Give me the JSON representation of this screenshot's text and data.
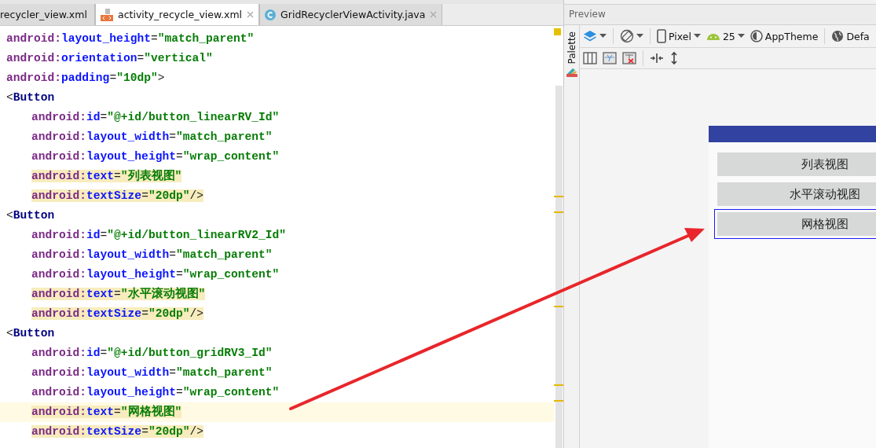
{
  "editor": {
    "tabs": [
      {
        "label": "recycler_view.xml",
        "selected": false
      },
      {
        "label": "activity_recycle_view.xml",
        "selected": true
      },
      {
        "label": "GridRecyclerViewActivity.java",
        "selected": false
      }
    ],
    "lines": [
      {
        "highlighted": false,
        "current": false,
        "segments": [
          {
            "kind": "ns",
            "text": "android:"
          },
          {
            "kind": "attr",
            "text": "layout_height"
          },
          {
            "kind": "punct",
            "text": "="
          },
          {
            "kind": "value",
            "text": "\"match_parent\""
          }
        ]
      },
      {
        "highlighted": false,
        "current": false,
        "segments": [
          {
            "kind": "ns",
            "text": "android:"
          },
          {
            "kind": "attr",
            "text": "orientation"
          },
          {
            "kind": "punct",
            "text": "="
          },
          {
            "kind": "value",
            "text": "\"vertical\""
          }
        ]
      },
      {
        "highlighted": false,
        "current": false,
        "segments": [
          {
            "kind": "ns",
            "text": "android:"
          },
          {
            "kind": "attr",
            "text": "padding"
          },
          {
            "kind": "punct",
            "text": "="
          },
          {
            "kind": "value",
            "text": "\"10dp\""
          },
          {
            "kind": "punct",
            "text": ">"
          }
        ]
      },
      {
        "highlighted": false,
        "current": false,
        "segments": [
          {
            "kind": "punct",
            "text": "<"
          },
          {
            "kind": "tag",
            "text": "Button"
          }
        ],
        "children": [
          {
            "highlighted": false,
            "current": false,
            "segments": [
              {
                "kind": "ns",
                "text": "android:"
              },
              {
                "kind": "attr",
                "text": "id"
              },
              {
                "kind": "punct",
                "text": "="
              },
              {
                "kind": "value",
                "text": "\"@+id/button_linearRV_Id\""
              }
            ]
          },
          {
            "highlighted": false,
            "current": false,
            "segments": [
              {
                "kind": "ns",
                "text": "android:"
              },
              {
                "kind": "attr",
                "text": "layout_width"
              },
              {
                "kind": "punct",
                "text": "="
              },
              {
                "kind": "value",
                "text": "\"match_parent\""
              }
            ]
          },
          {
            "highlighted": false,
            "current": false,
            "segments": [
              {
                "kind": "ns",
                "text": "android:"
              },
              {
                "kind": "attr",
                "text": "layout_height"
              },
              {
                "kind": "punct",
                "text": "="
              },
              {
                "kind": "value",
                "text": "\"wrap_content\""
              }
            ]
          },
          {
            "highlighted": true,
            "current": false,
            "segments": [
              {
                "kind": "ns",
                "text": "android:"
              },
              {
                "kind": "attr",
                "text": "text"
              },
              {
                "kind": "punct",
                "text": "="
              },
              {
                "kind": "value",
                "text": "\"列表视图\""
              }
            ]
          },
          {
            "highlighted": true,
            "current": false,
            "segments": [
              {
                "kind": "ns",
                "text": "android:"
              },
              {
                "kind": "attr",
                "text": "textSize"
              },
              {
                "kind": "punct",
                "text": "="
              },
              {
                "kind": "value",
                "text": "\"20dp\""
              },
              {
                "kind": "punct",
                "text": "/>"
              }
            ]
          }
        ]
      },
      {
        "highlighted": false,
        "current": false,
        "segments": [
          {
            "kind": "punct",
            "text": "<"
          },
          {
            "kind": "tag",
            "text": "Button"
          }
        ],
        "children": [
          {
            "highlighted": false,
            "current": false,
            "segments": [
              {
                "kind": "ns",
                "text": "android:"
              },
              {
                "kind": "attr",
                "text": "id"
              },
              {
                "kind": "punct",
                "text": "="
              },
              {
                "kind": "value",
                "text": "\"@+id/button_linearRV2_Id\""
              }
            ]
          },
          {
            "highlighted": false,
            "current": false,
            "segments": [
              {
                "kind": "ns",
                "text": "android:"
              },
              {
                "kind": "attr",
                "text": "layout_width"
              },
              {
                "kind": "punct",
                "text": "="
              },
              {
                "kind": "value",
                "text": "\"match_parent\""
              }
            ]
          },
          {
            "highlighted": false,
            "current": false,
            "segments": [
              {
                "kind": "ns",
                "text": "android:"
              },
              {
                "kind": "attr",
                "text": "layout_height"
              },
              {
                "kind": "punct",
                "text": "="
              },
              {
                "kind": "value",
                "text": "\"wrap_content\""
              }
            ]
          },
          {
            "highlighted": true,
            "current": false,
            "segments": [
              {
                "kind": "ns",
                "text": "android:"
              },
              {
                "kind": "attr",
                "text": "text"
              },
              {
                "kind": "punct",
                "text": "="
              },
              {
                "kind": "value",
                "text": "\"水平滚动视图\""
              }
            ]
          },
          {
            "highlighted": true,
            "current": false,
            "segments": [
              {
                "kind": "ns",
                "text": "android:"
              },
              {
                "kind": "attr",
                "text": "textSize"
              },
              {
                "kind": "punct",
                "text": "="
              },
              {
                "kind": "value",
                "text": "\"20dp\""
              },
              {
                "kind": "punct",
                "text": "/>"
              }
            ]
          }
        ]
      },
      {
        "highlighted": false,
        "current": false,
        "segments": [
          {
            "kind": "punct",
            "text": "<"
          },
          {
            "kind": "tag",
            "text": "Button"
          }
        ],
        "children": [
          {
            "highlighted": false,
            "current": false,
            "segments": [
              {
                "kind": "ns",
                "text": "android:"
              },
              {
                "kind": "attr",
                "text": "id"
              },
              {
                "kind": "punct",
                "text": "="
              },
              {
                "kind": "value",
                "text": "\"@+id/button_gridRV3_Id\""
              }
            ]
          },
          {
            "highlighted": false,
            "current": false,
            "segments": [
              {
                "kind": "ns",
                "text": "android:"
              },
              {
                "kind": "attr",
                "text": "layout_width"
              },
              {
                "kind": "punct",
                "text": "="
              },
              {
                "kind": "value",
                "text": "\"match_parent\""
              }
            ]
          },
          {
            "highlighted": false,
            "current": false,
            "segments": [
              {
                "kind": "ns",
                "text": "android:"
              },
              {
                "kind": "attr",
                "text": "layout_height"
              },
              {
                "kind": "punct",
                "text": "="
              },
              {
                "kind": "value",
                "text": "\"wrap_content\""
              }
            ]
          },
          {
            "highlighted": true,
            "current": true,
            "segments": [
              {
                "kind": "ns",
                "text": "android:"
              },
              {
                "kind": "attr",
                "text": "text"
              },
              {
                "kind": "punct",
                "text": "="
              },
              {
                "kind": "value",
                "text": "\"网格视图\""
              }
            ]
          },
          {
            "highlighted": true,
            "current": false,
            "segments": [
              {
                "kind": "ns",
                "text": "android:"
              },
              {
                "kind": "attr",
                "text": "textSize"
              },
              {
                "kind": "punct",
                "text": "="
              },
              {
                "kind": "value",
                "text": "\"20dp\""
              },
              {
                "kind": "punct",
                "text": "/>"
              }
            ]
          }
        ]
      }
    ]
  },
  "preview": {
    "title": "Preview",
    "palette_label": "Palette",
    "toolbar": [
      {
        "label": "Pixel"
      },
      {
        "label": "25"
      },
      {
        "label": "AppTheme"
      },
      {
        "label": "Defa"
      }
    ],
    "device_buttons": [
      {
        "text": "列表视图",
        "selected": false
      },
      {
        "text": "水平滚动视图",
        "selected": false
      },
      {
        "text": "网格视图",
        "selected": true
      }
    ]
  }
}
